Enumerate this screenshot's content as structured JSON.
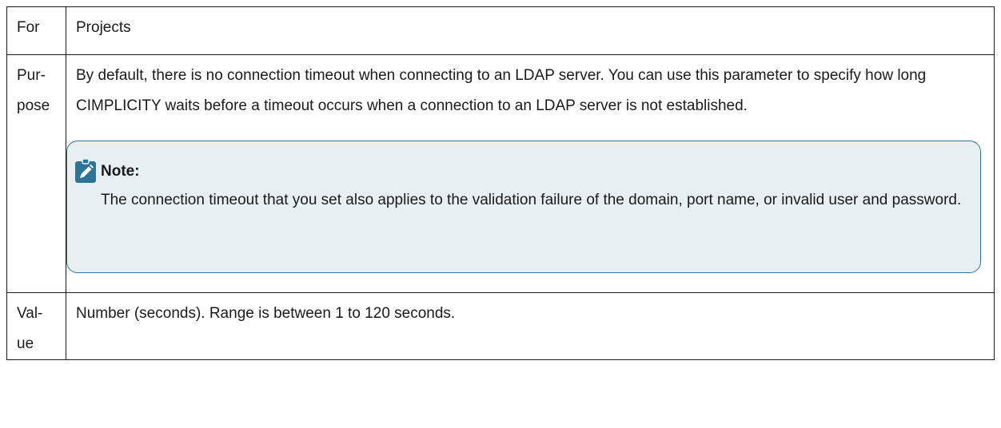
{
  "rows": {
    "for": {
      "key": "For",
      "value": "Projects"
    },
    "purpose": {
      "key_line1": "Pur-",
      "key_line2": "pose",
      "text": "By default, there is no connection timeout when connecting to an LDAP server. You can use this parameter to specify how long CIMPLICITY waits before a timeout occurs when a connection to an LDAP server is not established.",
      "note": {
        "icon": "pencil-note-icon",
        "title": "Note:",
        "text": "The connection timeout that you set also applies to the validation failure of the domain, port name, or invalid user and password."
      }
    },
    "value": {
      "key_line1": "Val-",
      "key_line2": "ue",
      "text": "Number (seconds). Range is between 1 to 120 seconds."
    }
  },
  "colors": {
    "note_background": "#e8eff3",
    "note_border": "#2e7497",
    "note_icon": "#2e7497"
  }
}
